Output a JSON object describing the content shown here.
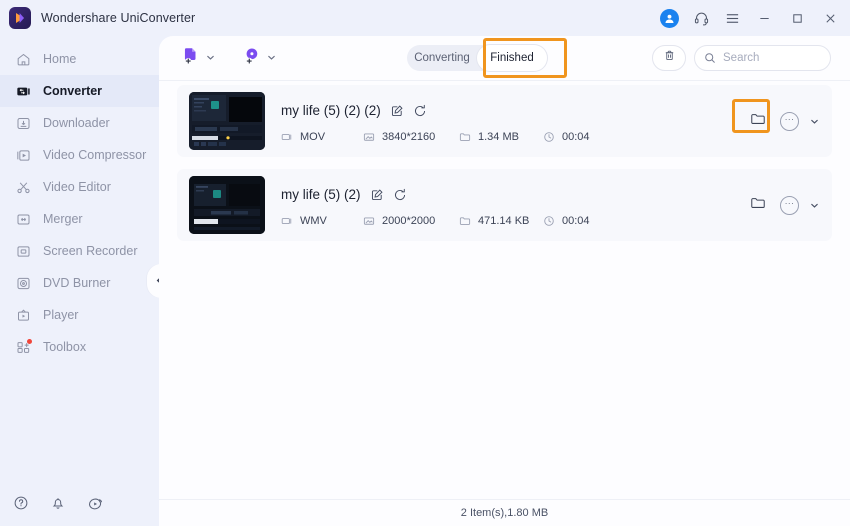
{
  "window": {
    "title": "Wondershare UniConverter",
    "logo_icon": "uniconverter-logo-icon",
    "account_icon": "account-avatar-icon",
    "support_icon": "headset-support-icon",
    "menu_icon": "hamburger-menu-icon",
    "minimize_icon": "minimize-icon",
    "maximize_icon": "maximize-icon",
    "close_icon": "close-icon"
  },
  "sidebar": {
    "collapse_icon": "collapse-left-chevron-icon",
    "items": [
      {
        "label": "Home",
        "icon": "home-icon",
        "active": false,
        "badge": false
      },
      {
        "label": "Converter",
        "icon": "converter-icon",
        "active": true,
        "badge": false
      },
      {
        "label": "Downloader",
        "icon": "downloader-icon",
        "active": false,
        "badge": false
      },
      {
        "label": "Video Compressor",
        "icon": "video-compressor-icon",
        "active": false,
        "badge": false
      },
      {
        "label": "Video Editor",
        "icon": "scissors-icon",
        "active": false,
        "badge": false
      },
      {
        "label": "Merger",
        "icon": "merger-icon",
        "active": false,
        "badge": false
      },
      {
        "label": "Screen Recorder",
        "icon": "screen-recorder-icon",
        "active": false,
        "badge": false
      },
      {
        "label": "DVD Burner",
        "icon": "dvd-burner-icon",
        "active": false,
        "badge": false
      },
      {
        "label": "Player",
        "icon": "player-icon",
        "active": false,
        "badge": false
      },
      {
        "label": "Toolbox",
        "icon": "toolbox-icon",
        "active": false,
        "badge": true
      }
    ],
    "bottom_icons": [
      {
        "icon": "help-question-icon"
      },
      {
        "icon": "notification-bell-icon"
      },
      {
        "icon": "video-tutorial-icon"
      }
    ]
  },
  "toolbar": {
    "add_files_icon": "add-files-icon",
    "add_files_chevron": "chevron-down-icon",
    "add_dvd_icon": "add-dvd-icon",
    "add_dvd_chevron": "chevron-down-icon",
    "tabs": [
      {
        "label": "Converting",
        "active": false
      },
      {
        "label": "Finished",
        "active": true
      }
    ],
    "trash_icon": "trash-icon",
    "search": {
      "icon": "search-icon",
      "placeholder": "Search",
      "value": ""
    }
  },
  "highlights": {
    "accent_color": "#f0951e",
    "finished_tab": "highlight-finished-tab",
    "open_folder": "highlight-open-folder-button"
  },
  "files": [
    {
      "name": "my life (5) (2) (2)",
      "edit_icon": "edit-icon",
      "convert_again_icon": "convert-again-icon",
      "format": "MOV",
      "resolution": "3840*2160",
      "size": "1.34 MB",
      "duration": "00:04",
      "format_icon": "video-format-icon",
      "resolution_icon": "resolution-icon",
      "size_icon": "folder-size-icon",
      "duration_icon": "clock-icon",
      "folder_icon": "open-folder-icon",
      "more_icon": "more-options-icon",
      "more_chevron_icon": "chevron-down-icon",
      "highlighted": true
    },
    {
      "name": "my life (5) (2)",
      "edit_icon": "edit-icon",
      "convert_again_icon": "convert-again-icon",
      "format": "WMV",
      "resolution": "2000*2000",
      "size": "471.14 KB",
      "duration": "00:04",
      "format_icon": "video-format-icon",
      "resolution_icon": "resolution-icon",
      "size_icon": "folder-size-icon",
      "duration_icon": "clock-icon",
      "folder_icon": "open-folder-icon",
      "more_icon": "more-options-icon",
      "more_chevron_icon": "chevron-down-icon",
      "highlighted": false
    }
  ],
  "footer": {
    "status": "2 Item(s),1.80 MB"
  }
}
